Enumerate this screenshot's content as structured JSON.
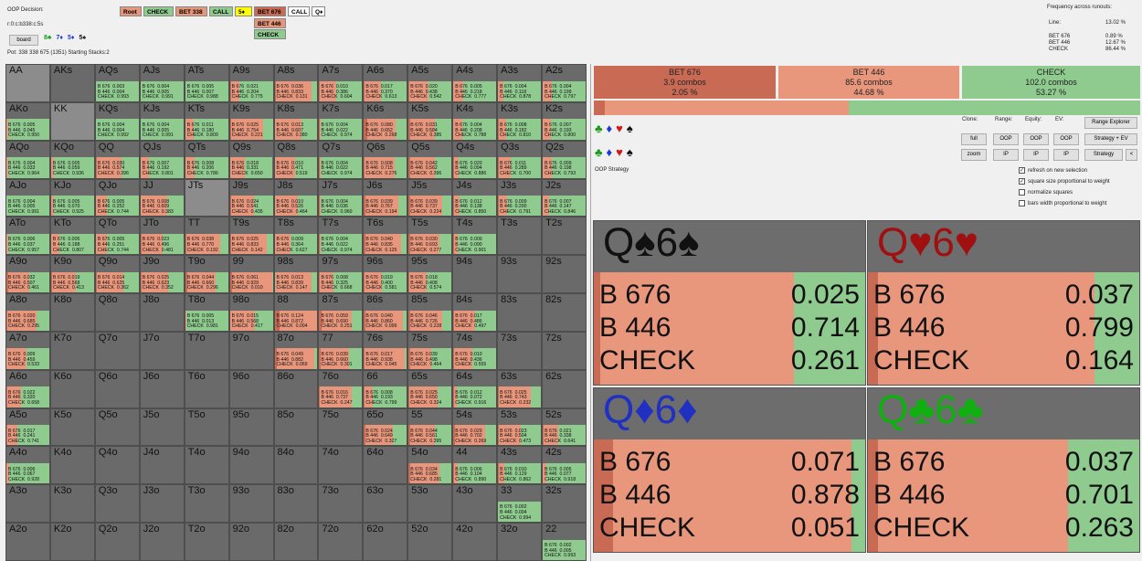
{
  "top": {
    "decision_title": "OOP Decision:",
    "path": "r:0:c:b338:c:5s",
    "board_button": "board",
    "board_cards": [
      {
        "rank": "8",
        "suit": "♣",
        "color": "#1a9a1a"
      },
      {
        "rank": "7",
        "suit": "♦",
        "color": "#1a3ad0"
      },
      {
        "rank": "5",
        "suit": "♦",
        "color": "#1a3ad0"
      },
      {
        "rank": "5",
        "suit": "♠",
        "color": "#111111"
      }
    ],
    "pot_line": "Pot: 338 338 675 (1351) Starting Stacks:2",
    "chips_row1": [
      {
        "label": "Root",
        "bg": "#e6967a"
      },
      {
        "label": "CHECK",
        "bg": "#8fca8f"
      },
      {
        "label": "BET 338",
        "bg": "#e6967a"
      },
      {
        "label": "CALL",
        "bg": "#8fca8f"
      },
      {
        "label": "5♦",
        "bg": "#ffff00"
      },
      {
        "label": "BET 676",
        "bg": "#c96a55"
      },
      {
        "label": "CALL",
        "bg": "#ffffff"
      },
      {
        "label": "Q♦",
        "bg": "#ffffff"
      }
    ],
    "chips_col": [
      {
        "label": "BET 446",
        "bg": "#e6967a"
      },
      {
        "label": "CHECK",
        "bg": "#8fca8f"
      }
    ],
    "freq_title": "Frequency across runouts:",
    "line_label": "Line:",
    "line_value": "13.02 %",
    "freq_rows": [
      {
        "label": "BET 676",
        "value": "0.89 %"
      },
      {
        "label": "BET 446",
        "value": "12.67 %"
      },
      {
        "label": "CHECK",
        "value": "86.44 %"
      }
    ]
  },
  "grid": {
    "ranks": [
      "A",
      "K",
      "Q",
      "J",
      "T",
      "9",
      "8",
      "7",
      "6",
      "5",
      "4",
      "3",
      "2"
    ],
    "cells": {
      "AA": null,
      "AKs": null,
      "AQs": [
        0.003,
        0.004,
        0.993
      ],
      "AJs": [
        0.004,
        0.005,
        0.991
      ],
      "ATs": [
        0.005,
        0.007,
        0.988
      ],
      "A9s": [
        0.021,
        0.204,
        0.775
      ],
      "A8s": [
        0.036,
        0.833,
        0.131
      ],
      "A7s": [
        0.01,
        0.386,
        0.604
      ],
      "A6s": [
        0.017,
        0.37,
        0.613
      ],
      "A5s": [
        0.02,
        0.438,
        0.542
      ],
      "A4s": [
        0.005,
        0.218,
        0.777
      ],
      "A3s": [
        0.004,
        0.118,
        0.878
      ],
      "A2s": [
        0.004,
        0.199,
        0.797
      ],
      "AKo": [
        0.005,
        0.045,
        0.95
      ],
      "KK": null,
      "KQs": [
        0.004,
        0.004,
        0.992
      ],
      "KJs": [
        0.004,
        0.005,
        0.991
      ],
      "KTs": [
        0.011,
        0.18,
        0.809
      ],
      "K9s": [
        0.025,
        0.754,
        0.221
      ],
      "K8s": [
        0.013,
        0.607,
        0.38
      ],
      "K7s": [
        0.004,
        0.022,
        0.974
      ],
      "K6s": [
        0.08,
        0.652,
        0.268
      ],
      "K5s": [
        0.031,
        0.584,
        0.385
      ],
      "K4s": [
        0.004,
        0.208,
        0.788
      ],
      "K3s": [
        0.008,
        0.182,
        0.81
      ],
      "K2s": [
        0.007,
        0.193,
        0.8
      ],
      "AQo": [
        0.004,
        0.033,
        0.964
      ],
      "KQo": [
        0.005,
        0.059,
        0.936
      ],
      "QQ": [
        0.03,
        0.574,
        0.396
      ],
      "QJs": [
        0.007,
        0.192,
        0.801
      ],
      "QTs": [
        0.008,
        0.206,
        0.786
      ],
      "Q9s": [
        0.018,
        0.331,
        0.65
      ],
      "Q8s": [
        0.01,
        0.471,
        0.519
      ],
      "Q7s": [
        0.004,
        0.022,
        0.974
      ],
      "Q6s": [
        0.008,
        0.715,
        0.276
      ],
      "Q5s": [
        0.042,
        0.562,
        0.396
      ],
      "Q4s": [
        0.02,
        0.094,
        0.886
      ],
      "Q3s": [
        0.011,
        0.289,
        0.7
      ],
      "Q2s": [
        0.009,
        0.198,
        0.793
      ],
      "AJo": [
        0.004,
        0.005,
        0.991
      ],
      "KJo": [
        0.005,
        0.07,
        0.925
      ],
      "QJo": [
        0.005,
        0.252,
        0.744
      ],
      "JJ": [
        0.008,
        0.609,
        0.383
      ],
      "JTs": null,
      "J9s": [
        0.024,
        0.541,
        0.435
      ],
      "J8s": [
        0.01,
        0.526,
        0.464
      ],
      "J7s": [
        0.004,
        0.036,
        0.96
      ],
      "J6s": [
        0.039,
        0.767,
        0.194
      ],
      "J5s": [
        0.039,
        0.737,
        0.224
      ],
      "J4s": [
        0.012,
        0.138,
        0.85
      ],
      "J3s": [
        0.009,
        0.2,
        0.791
      ],
      "J2s": [
        0.007,
        0.147,
        0.846
      ],
      "ATo": [
        0.006,
        0.037,
        0.957
      ],
      "KTo": [
        0.005,
        0.188,
        0.807
      ],
      "QTo": [
        0.005,
        0.251,
        0.744
      ],
      "JTo": [
        0.023,
        0.496,
        0.481
      ],
      "TT": [
        0.038,
        0.77,
        0.192
      ],
      "T9s": [
        0.025,
        0.833,
        0.142
      ],
      "T8s": [
        0.009,
        0.364,
        0.627
      ],
      "T7s": [
        0.004,
        0.022,
        0.974
      ],
      "T6s": [
        0.04,
        0.835,
        0.125
      ],
      "T5s": [
        0.03,
        0.693,
        0.277
      ],
      "T4s": [
        0.009,
        0.09,
        0.901
      ],
      "T3s": null,
      "T2s": null,
      "A9o": [
        0.032,
        0.507,
        0.461
      ],
      "K9o": [
        0.019,
        0.568,
        0.413
      ],
      "Q9o": [
        0.014,
        0.625,
        0.362
      ],
      "J9o": [
        0.025,
        0.623,
        0.352
      ],
      "T9o": [
        0.044,
        0.66,
        0.296
      ],
      "99": [
        0.061,
        0.929,
        0.01
      ],
      "98s": [
        0.013,
        0.839,
        0.147
      ],
      "97s": [
        0.008,
        0.325,
        0.668
      ],
      "96s": [
        0.019,
        0.4,
        0.581
      ],
      "95s": [
        0.018,
        0.408,
        0.574
      ],
      "94s": null,
      "93s": null,
      "92s": null,
      "A8o": [
        0.02,
        0.685,
        0.295
      ],
      "K8o": null,
      "Q8o": null,
      "J8o": null,
      "T8o": [
        0.005,
        0.013,
        0.981
      ],
      "98o": [
        0.015,
        0.568,
        0.417
      ],
      "88": [
        0.124,
        0.872,
        0.004
      ],
      "87s": [
        0.059,
        0.69,
        0.251
      ],
      "86s": [
        0.04,
        0.86,
        0.099
      ],
      "85s": [
        0.046,
        0.726,
        0.228
      ],
      "84s": [
        0.017,
        0.486,
        0.497
      ],
      "83s": null,
      "82s": null,
      "A7o": [
        0.009,
        0.459,
        0.533
      ],
      "K7o": null,
      "Q7o": null,
      "J7o": null,
      "T7o": null,
      "97o": null,
      "87o": [
        0.049,
        0.882,
        0.069
      ],
      "77": [
        0.039,
        0.66,
        0.301
      ],
      "76s": [
        0.017,
        0.938,
        0.045
      ],
      "75s": [
        0.039,
        0.498,
        0.464
      ],
      "74s": [
        0.01,
        0.436,
        0.555
      ],
      "73s": null,
      "72s": null,
      "A6o": [
        0.022,
        0.32,
        0.658
      ],
      "K6o": null,
      "Q6o": null,
      "J6o": null,
      "T6o": null,
      "96o": null,
      "86o": null,
      "76o": [
        0.016,
        0.737,
        0.247
      ],
      "66": [
        0.008,
        0.193,
        0.799
      ],
      "65s": [
        0.025,
        0.65,
        0.324
      ],
      "64s": [
        0.012,
        0.072,
        0.916
      ],
      "63s": [
        0.025,
        0.743,
        0.232
      ],
      "62s": null,
      "A5o": [
        0.017,
        0.241,
        0.741
      ],
      "K5o": null,
      "Q5o": null,
      "J5o": null,
      "T5o": null,
      "95o": null,
      "85o": null,
      "75o": null,
      "65o": [
        0.024,
        0.649,
        0.327
      ],
      "55": [
        0.044,
        0.561,
        0.395
      ],
      "54s": [
        0.029,
        0.702,
        0.269
      ],
      "53s": [
        0.023,
        0.504,
        0.473
      ],
      "52s": [
        0.021,
        0.338,
        0.641
      ],
      "A4o": [
        0.006,
        0.067,
        0.928
      ],
      "K4o": null,
      "Q4o": null,
      "J4o": null,
      "T4o": null,
      "94o": null,
      "84o": null,
      "74o": null,
      "64o": null,
      "54o": [
        0.034,
        0.685,
        0.281
      ],
      "44": [
        0.006,
        0.104,
        0.89
      ],
      "43s": [
        0.01,
        0.129,
        0.862
      ],
      "42s": [
        0.005,
        0.077,
        0.918
      ],
      "A3o": null,
      "K3o": null,
      "Q3o": null,
      "J3o": null,
      "T3o": null,
      "93o": null,
      "83o": null,
      "73o": null,
      "63o": null,
      "53o": null,
      "43o": null,
      "33": [
        0.002,
        0.004,
        0.994
      ],
      "32s": null,
      "A2o": null,
      "K2o": null,
      "Q2o": null,
      "J2o": null,
      "T2o": null,
      "92o": null,
      "82o": null,
      "72o": null,
      "62o": null,
      "52o": null,
      "42o": null,
      "32o": null,
      "22": [
        0.002,
        0.005,
        0.993
      ]
    },
    "action_labels": [
      "B 676",
      "B 446",
      "CHECK"
    ],
    "colors": {
      "bet_big": "#c96a55",
      "bet_small": "#e8977d",
      "check": "#8fca8f",
      "empty": "#6a6a6a"
    }
  },
  "summary": [
    {
      "label": "BET 676",
      "combos": "3.9 combos",
      "pct": "2.05 %",
      "frac": 0.0205,
      "bg": "#c96a55"
    },
    {
      "label": "BET 446",
      "combos": "85.6 combos",
      "pct": "44.68 %",
      "frac": 0.4468,
      "bg": "#e8977d"
    },
    {
      "label": "CHECK",
      "combos": "102.0 combos",
      "pct": "53.27 %",
      "frac": 0.5327,
      "bg": "#8fca8f"
    }
  ],
  "controls": {
    "suits": [
      {
        "g": "♣",
        "color": "#1a9a1a"
      },
      {
        "g": "♦",
        "color": "#1a3ad0"
      },
      {
        "g": "♥",
        "color": "#d01a1a"
      },
      {
        "g": "♠",
        "color": "#111111"
      }
    ],
    "clone_label": "Clone:",
    "range_label": "Range:",
    "equity_label": "Equity:",
    "ev_label": "EV:",
    "full_btn": "full",
    "zoom_btn": "zoom",
    "oop_btn": "OOP",
    "ip_btn": "IP",
    "range_explorer_btn": "Range Explorer",
    "strategy_ev_btn": "Strategy + EV",
    "strategy_btn": "Strategy",
    "back_btn": "<",
    "oop_strategy": "OOP Strategy",
    "checkboxes": [
      {
        "label": "refresh on new selection",
        "checked": true
      },
      {
        "label": "square size proportional to weight",
        "checked": true
      },
      {
        "label": "normalize squares",
        "checked": false
      },
      {
        "label": "bars width proportional to weight",
        "checked": false
      }
    ]
  },
  "combos": [
    {
      "rank1": "Q",
      "rank2": "6",
      "suit": "♠",
      "color": "#111111",
      "values": [
        "0.025",
        "0.714",
        "0.261"
      ],
      "nums": [
        0.025,
        0.714,
        0.261
      ]
    },
    {
      "rank1": "Q",
      "rank2": "6",
      "suit": "♥",
      "color": "#a01010",
      "values": [
        "0.037",
        "0.799",
        "0.164"
      ],
      "nums": [
        0.037,
        0.799,
        0.164
      ]
    },
    {
      "rank1": "Q",
      "rank2": "6",
      "suit": "♦",
      "color": "#2030c0",
      "values": [
        "0.071",
        "0.878",
        "0.051"
      ],
      "nums": [
        0.071,
        0.878,
        0.051
      ]
    },
    {
      "rank1": "Q",
      "rank2": "6",
      "suit": "♣",
      "color": "#10b010",
      "values": [
        "0.037",
        "0.701",
        "0.263"
      ],
      "nums": [
        0.037,
        0.701,
        0.263
      ]
    }
  ]
}
